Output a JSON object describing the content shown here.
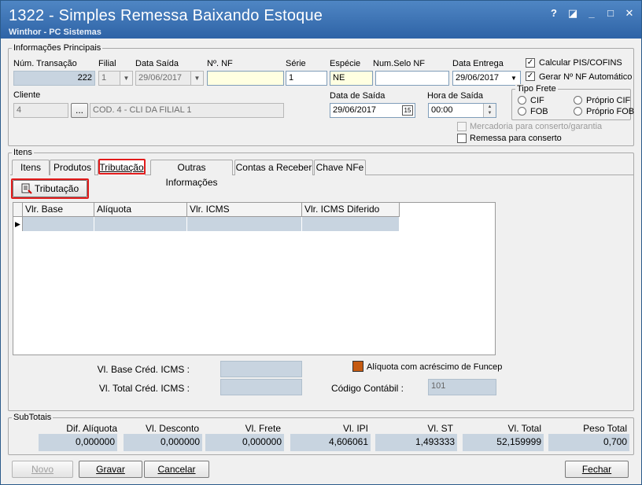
{
  "window": {
    "title": "1322 - Simples Remessa Baixando Estoque",
    "subtitle": "Winthor - PC Sistemas",
    "icons": [
      "help-icon",
      "edit-icon",
      "minimize-icon",
      "maximize-icon",
      "close-icon"
    ],
    "icon_glyphs": {
      "help": "?",
      "edit": "◪",
      "minimize": "_",
      "maximize": "□",
      "close": "✕"
    }
  },
  "info": {
    "group_label": "Informações Principais",
    "num_transacao_label": "Núm. Transação",
    "num_transacao": "222",
    "filial_label": "Filial",
    "filial": "1",
    "data_saida_label": "Data Saída",
    "data_saida": "29/06/2017",
    "nf_label": "Nº. NF",
    "nf": "",
    "serie_label": "Série",
    "serie": "1",
    "especie_label": "Espécie",
    "especie": "NE",
    "num_selo_label": "Num.Selo NF",
    "num_selo": "",
    "data_entrega_label": "Data Entrega",
    "data_entrega": "29/06/2017",
    "calcular_pis_label": "Calcular PIS/COFINS",
    "gerar_nf_label": "Gerar Nº NF Automático",
    "cliente_label": "Cliente",
    "cliente_code": "4",
    "cliente_btn": "...",
    "cliente_name": "COD. 4 - CLI DA FILIAL 1",
    "data_de_saida_label": "Data de Saída",
    "data_de_saida": "29/06/2017",
    "hora_saida_label": "Hora de Saída",
    "hora_saida": "00:00",
    "tipo_frete_label": "Tipo Frete",
    "frete_cif": "CIF",
    "frete_fob": "FOB",
    "frete_proprio_cif": "Próprio CIF",
    "frete_proprio_fob": "Próprio FOB",
    "mercadoria_label": "Mercadoria para conserto/garantia",
    "remessa_label": "Remessa para conserto"
  },
  "itens": {
    "group_label": "Itens",
    "tabs": [
      "Itens",
      "Produtos",
      "Tributação",
      "Outras Informações",
      "Contas a Receber",
      "Chave NFe"
    ],
    "tributacao_button": "Tributação",
    "columns": [
      "Vlr. Base",
      "Alíquota",
      "Vlr. ICMS",
      "Vlr. ICMS Diferido"
    ],
    "base_cred_label": "Vl. Base Créd. ICMS :",
    "total_cred_label": "Vl. Total Créd. ICMS :",
    "aliquota_legend": "Alíquota com acréscimo de Funcep",
    "codigo_contabil_label": "Código Contábil :",
    "codigo_contabil": "101",
    "legend_color": "#c55a11"
  },
  "subtotais": {
    "group_label": "SubTotais",
    "items": [
      {
        "label": "Dif. Alíquota",
        "value": "0,000000"
      },
      {
        "label": "Vl. Desconto",
        "value": "0,000000"
      },
      {
        "label": "Vl. Frete",
        "value": "0,000000"
      },
      {
        "label": "Vl. IPI",
        "value": "4,606061"
      },
      {
        "label": "Vl. ST",
        "value": "1,493333"
      },
      {
        "label": "Vl. Total",
        "value": "52,159999"
      },
      {
        "label": "Peso Total",
        "value": "0,700"
      }
    ]
  },
  "footer": {
    "novo": "Novo",
    "gravar": "Gravar",
    "cancelar": "Cancelar",
    "fechar": "Fechar"
  },
  "colors": {
    "titlebar": "#2e63a6",
    "highlight": "#e21b1b",
    "readonly": "#c8d4e0"
  }
}
